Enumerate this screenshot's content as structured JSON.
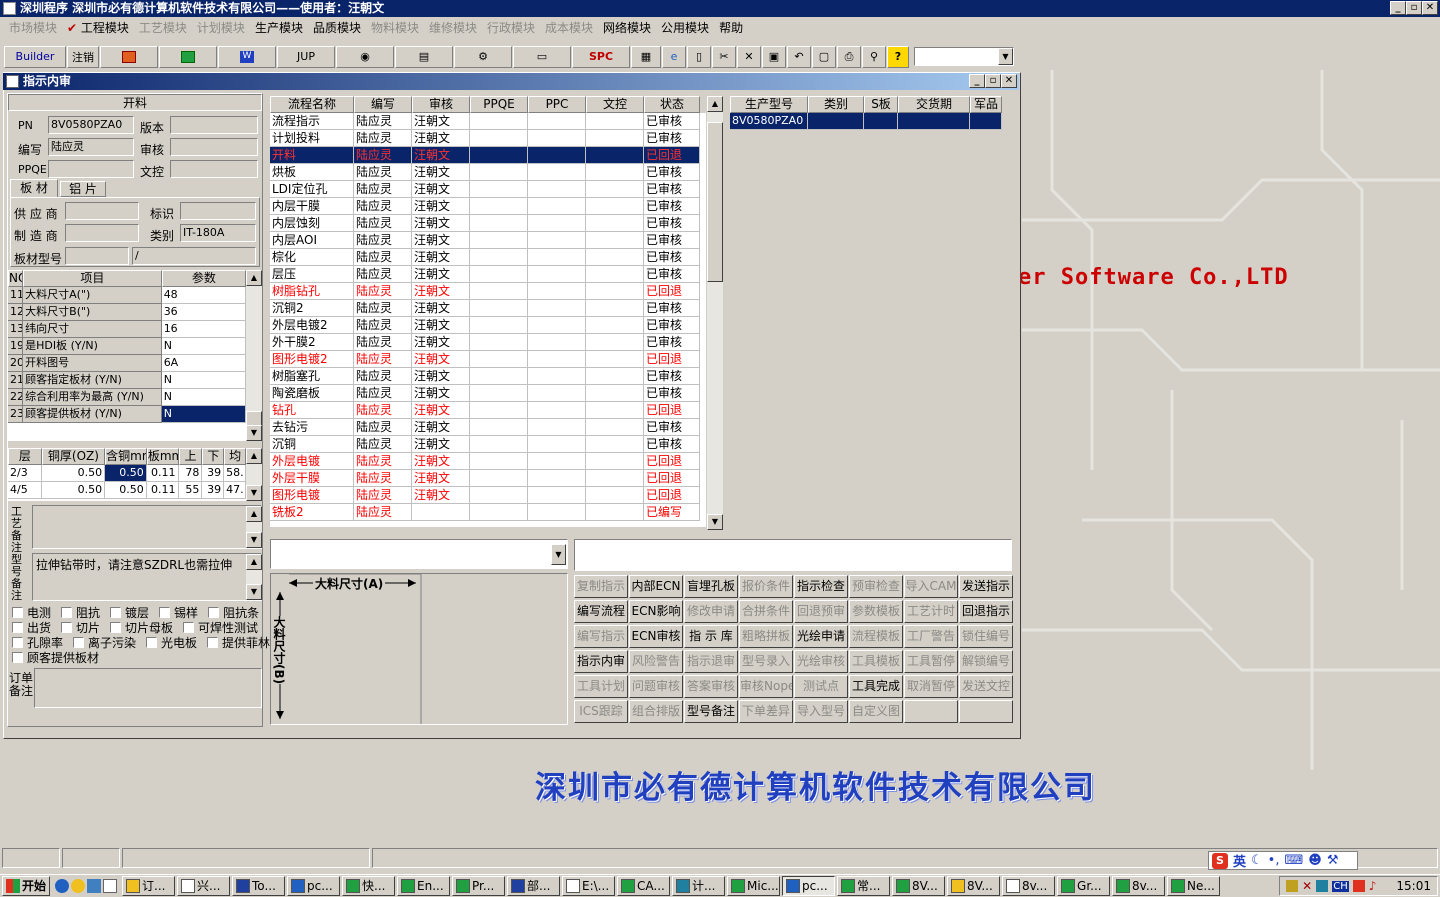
{
  "app": {
    "title": "深圳程序    深圳市必有德计算机软件技术有限公司——使用者：汪朝文"
  },
  "menu": [
    "市场模块",
    "工程模块",
    "工艺模块",
    "计划模块",
    "生产模块",
    "品质模块",
    "物料模块",
    "维修模块",
    "行政模块",
    "成本模块",
    "网络模块",
    "公用模块",
    "帮助"
  ],
  "menu_enabled": [
    false,
    true,
    false,
    false,
    true,
    true,
    false,
    false,
    false,
    false,
    true,
    true,
    true
  ],
  "toolbar": {
    "builder": "Builder",
    "logout": "注销",
    "jup": "JUP",
    "spc": "SPC"
  },
  "window": {
    "title": "指示内审"
  },
  "left": {
    "section_title": "开料",
    "pn_label": "PN",
    "pn_value": "8V0580PZA0",
    "version_label": "版本",
    "version_value": "",
    "author_label": "编写",
    "author_value": "陆应灵",
    "review_label": "审核",
    "review_value": "",
    "ppqe_label": "PPQE",
    "ppqe_value": "",
    "wenkong_label": "文控",
    "wenkong_value": "",
    "tabs": [
      "板 材",
      "铝 片"
    ],
    "supplier_label": "供 应 商",
    "supplier_value": "",
    "mark_label": "标识",
    "mark_value": "",
    "maker_label": "制 造 商",
    "maker_value": "",
    "type_label": "类别",
    "type_value": "IT-180A",
    "model_label": "板材型号",
    "model_value": "",
    "model_value2": "/",
    "params_header": [
      "NO",
      "项目",
      "参数"
    ],
    "params": [
      [
        "11",
        "大料尺寸A(\")",
        "48"
      ],
      [
        "12",
        "大料尺寸B(\")",
        "36"
      ],
      [
        "13",
        "纬向尺寸",
        "16"
      ],
      [
        "19",
        "是HDI板 (Y/N)",
        "N"
      ],
      [
        "20",
        "开料图号",
        "6A"
      ],
      [
        "21",
        "顾客指定板材 (Y/N)",
        "N"
      ],
      [
        "22",
        "综合利用率为最高 (Y/N)",
        "N"
      ],
      [
        "23",
        "顾客提供板材 (Y/N)",
        "N"
      ]
    ],
    "layer_header": [
      "层",
      "铜厚(OZ)",
      "含铜mm",
      "板mm",
      "上",
      "下",
      "均"
    ],
    "layers": [
      [
        "2/3",
        "0.50",
        "0.50",
        "0.11",
        "78",
        "39",
        "58."
      ],
      [
        "4/5",
        "0.50",
        "0.50",
        "0.11",
        "55",
        "39",
        "47."
      ]
    ],
    "craft_note_label": "工艺备注",
    "craft_note": "",
    "model_note_label": "型号备注",
    "model_note": "拉伸钻带时，请注意SZDRL也需拉伸",
    "checks": [
      [
        "电测",
        "阻抗",
        "镀层",
        "锡样",
        "阻抗条"
      ],
      [
        "出货",
        "切片",
        "切片母板",
        "可焊性测试"
      ],
      [
        "孔隙率",
        "离子污染",
        "光电板",
        "提供菲林"
      ],
      [
        "顾客提供板材"
      ]
    ],
    "order_note_label": "订单备注"
  },
  "flow": {
    "header": [
      "流程名称",
      "编写",
      "审核",
      "PPQE",
      "PPC",
      "文控",
      "状态"
    ],
    "rows": [
      [
        "流程指示",
        "陆应灵",
        "汪朝文",
        "",
        "",
        "",
        "已审核"
      ],
      [
        "计划投料",
        "陆应灵",
        "汪朝文",
        "",
        "",
        "",
        "已审核"
      ],
      [
        "开料",
        "陆应灵",
        "汪朝文",
        "",
        "",
        "",
        "已回退"
      ],
      [
        "烘板",
        "陆应灵",
        "汪朝文",
        "",
        "",
        "",
        "已审核"
      ],
      [
        "LDI定位孔",
        "陆应灵",
        "汪朝文",
        "",
        "",
        "",
        "已审核"
      ],
      [
        "内层干膜",
        "陆应灵",
        "汪朝文",
        "",
        "",
        "",
        "已审核"
      ],
      [
        "内层蚀刻",
        "陆应灵",
        "汪朝文",
        "",
        "",
        "",
        "已审核"
      ],
      [
        "内层AOI",
        "陆应灵",
        "汪朝文",
        "",
        "",
        "",
        "已审核"
      ],
      [
        "棕化",
        "陆应灵",
        "汪朝文",
        "",
        "",
        "",
        "已审核"
      ],
      [
        "层压",
        "陆应灵",
        "汪朝文",
        "",
        "",
        "",
        "已审核"
      ],
      [
        "树脂钻孔",
        "陆应灵",
        "汪朝文",
        "",
        "",
        "",
        "已回退"
      ],
      [
        "沉铜2",
        "陆应灵",
        "汪朝文",
        "",
        "",
        "",
        "已审核"
      ],
      [
        "外层电镀2",
        "陆应灵",
        "汪朝文",
        "",
        "",
        "",
        "已审核"
      ],
      [
        "外干膜2",
        "陆应灵",
        "汪朝文",
        "",
        "",
        "",
        "已审核"
      ],
      [
        "图形电镀2",
        "陆应灵",
        "汪朝文",
        "",
        "",
        "",
        "已回退"
      ],
      [
        "树脂塞孔",
        "陆应灵",
        "汪朝文",
        "",
        "",
        "",
        "已审核"
      ],
      [
        "陶瓷磨板",
        "陆应灵",
        "汪朝文",
        "",
        "",
        "",
        "已审核"
      ],
      [
        "钻孔",
        "陆应灵",
        "汪朝文",
        "",
        "",
        "",
        "已回退"
      ],
      [
        "去钻污",
        "陆应灵",
        "汪朝文",
        "",
        "",
        "",
        "已审核"
      ],
      [
        "沉铜",
        "陆应灵",
        "汪朝文",
        "",
        "",
        "",
        "已审核"
      ],
      [
        "外层电镀",
        "陆应灵",
        "汪朝文",
        "",
        "",
        "",
        "已回退"
      ],
      [
        "外层干膜",
        "陆应灵",
        "汪朝文",
        "",
        "",
        "",
        "已回退"
      ],
      [
        "图形电镀",
        "陆应灵",
        "汪朝文",
        "",
        "",
        "",
        "已回退"
      ],
      [
        "铣板2",
        "陆应灵",
        "",
        "",
        "",
        "",
        "已编写"
      ]
    ],
    "row_state": [
      "n",
      "n",
      "sel",
      "n",
      "n",
      "n",
      "n",
      "n",
      "n",
      "n",
      "red",
      "n",
      "n",
      "n",
      "red",
      "n",
      "n",
      "red",
      "n",
      "n",
      "red",
      "red",
      "red",
      "red"
    ]
  },
  "model_grid": {
    "header": [
      "生产型号",
      "类别",
      "S板",
      "交货期",
      "军品"
    ],
    "rows": [
      [
        "8V0580PZA0",
        "",
        "",
        "",
        ""
      ]
    ]
  },
  "diagram": {
    "dim_a": "大料尺寸(A)",
    "dim_b": "大料尺寸(B)"
  },
  "actions": [
    [
      "复制指示",
      "内部ECN",
      "盲埋孔板",
      "报价条件",
      "指示检查",
      "预审检查",
      "导入CAM",
      "发送指示"
    ],
    [
      "编写流程",
      "ECN影响",
      "修改申请",
      "合拼条件",
      "回退预审",
      "参数模板",
      "工艺计时",
      "回退指示"
    ],
    [
      "编写指示",
      "ECN审核",
      "指 示 库",
      "粗略拼板",
      "光绘申请",
      "流程模板",
      "工厂警告",
      "锁住编号"
    ],
    [
      "指示内审",
      "风险警告",
      "指示退审",
      "型号录入",
      "光绘审核",
      "工具模板",
      "工具暂停",
      "解锁编号"
    ],
    [
      "工具计划",
      "问题审核",
      "答案审核",
      "审核Nope",
      "测试点",
      "工具完成",
      "取消暂停",
      "发送文控"
    ],
    [
      "ICS跟踪",
      "组合排版",
      "型号备注",
      "下单差异",
      "导入型号",
      "自定义图",
      "",
      ""
    ]
  ],
  "actions_enabled": [
    [
      false,
      true,
      true,
      false,
      true,
      false,
      false,
      true
    ],
    [
      true,
      true,
      false,
      false,
      false,
      false,
      false,
      true
    ],
    [
      false,
      true,
      true,
      false,
      true,
      false,
      false,
      false
    ],
    [
      true,
      false,
      false,
      false,
      false,
      false,
      false,
      false
    ],
    [
      false,
      false,
      false,
      false,
      false,
      true,
      false,
      false
    ],
    [
      false,
      false,
      true,
      false,
      false,
      false,
      false,
      false
    ]
  ],
  "watermark": {
    "software": "er Software Co.,LTD",
    "company": "深圳市必有德计算机软件技术有限公司"
  },
  "taskbar": {
    "start": "开始",
    "tasks": [
      "订...",
      "兴...",
      "To...",
      "pc...",
      "快...",
      "En...",
      "Pr...",
      "部...",
      "E:\\...",
      "CA...",
      "计...",
      "Mic...",
      "pc...",
      "常...",
      "8V...",
      "8V...",
      "8v...",
      "Gr...",
      "8v...",
      "Ne..."
    ],
    "ime": "英",
    "tray_lang": "CH",
    "clock": "15:01"
  }
}
